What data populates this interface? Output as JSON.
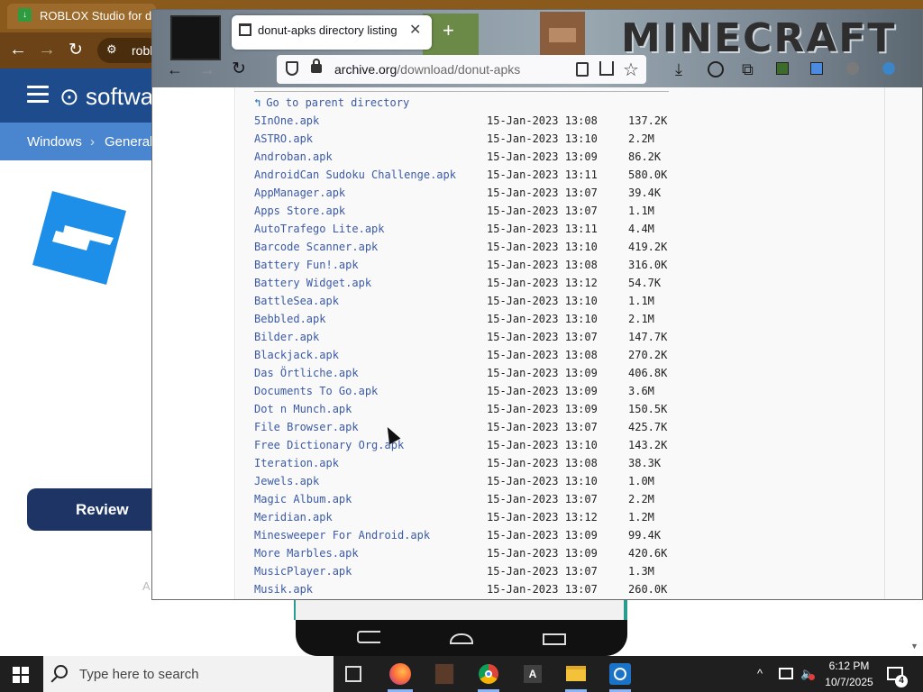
{
  "chrome": {
    "tab_title": "ROBLOX Studio for dell",
    "omnibox_text": "roblo",
    "site_logo": "softwa",
    "breadcrumb": [
      "Windows",
      "›",
      "General"
    ],
    "review_button": "Review",
    "ad_label": "A"
  },
  "firefox": {
    "tab_title": "donut-apks directory listing",
    "url_host": "archive.org",
    "url_path": "/download/donut-apks",
    "title_art": "MINECRAFT",
    "parent_link": "Go to parent directory",
    "parent_icon": "↰",
    "files": [
      {
        "name": "5InOne.apk",
        "date": "15-Jan-2023 13:08",
        "size": "137.2K"
      },
      {
        "name": "ASTRO.apk",
        "date": "15-Jan-2023 13:10",
        "size": "2.2M"
      },
      {
        "name": "Androban.apk",
        "date": "15-Jan-2023 13:09",
        "size": "86.2K"
      },
      {
        "name": "AndroidCan Sudoku Challenge.apk",
        "date": "15-Jan-2023 13:11",
        "size": "580.0K"
      },
      {
        "name": "AppManager.apk",
        "date": "15-Jan-2023 13:07",
        "size": "39.4K"
      },
      {
        "name": "Apps Store.apk",
        "date": "15-Jan-2023 13:07",
        "size": "1.1M"
      },
      {
        "name": "AutoTrafego Lite.apk",
        "date": "15-Jan-2023 13:11",
        "size": "4.4M"
      },
      {
        "name": "Barcode Scanner.apk",
        "date": "15-Jan-2023 13:10",
        "size": "419.2K"
      },
      {
        "name": "Battery Fun!.apk",
        "date": "15-Jan-2023 13:08",
        "size": "316.0K"
      },
      {
        "name": "Battery Widget.apk",
        "date": "15-Jan-2023 13:12",
        "size": "54.7K"
      },
      {
        "name": "BattleSea.apk",
        "date": "15-Jan-2023 13:10",
        "size": "1.1M"
      },
      {
        "name": "Bebbled.apk",
        "date": "15-Jan-2023 13:10",
        "size": "2.1M"
      },
      {
        "name": "Bilder.apk",
        "date": "15-Jan-2023 13:07",
        "size": "147.7K"
      },
      {
        "name": "Blackjack.apk",
        "date": "15-Jan-2023 13:08",
        "size": "270.2K"
      },
      {
        "name": "Das Örtliche.apk",
        "date": "15-Jan-2023 13:09",
        "size": "406.8K"
      },
      {
        "name": "Documents To Go.apk",
        "date": "15-Jan-2023 13:09",
        "size": "3.6M"
      },
      {
        "name": "Dot n Munch.apk",
        "date": "15-Jan-2023 13:09",
        "size": "150.5K"
      },
      {
        "name": "File Browser.apk",
        "date": "15-Jan-2023 13:07",
        "size": "425.7K"
      },
      {
        "name": "Free Dictionary Org.apk",
        "date": "15-Jan-2023 13:10",
        "size": "143.2K"
      },
      {
        "name": "Iteration.apk",
        "date": "15-Jan-2023 13:08",
        "size": "38.3K"
      },
      {
        "name": "Jewels.apk",
        "date": "15-Jan-2023 13:10",
        "size": "1.0M"
      },
      {
        "name": "Magic Album.apk",
        "date": "15-Jan-2023 13:07",
        "size": "2.2M"
      },
      {
        "name": "Meridian.apk",
        "date": "15-Jan-2023 13:12",
        "size": "1.2M"
      },
      {
        "name": "Minesweeper For Android.apk",
        "date": "15-Jan-2023 13:09",
        "size": "99.4K"
      },
      {
        "name": "More Marbles.apk",
        "date": "15-Jan-2023 13:09",
        "size": "420.6K"
      },
      {
        "name": "MusicPlayer.apk",
        "date": "15-Jan-2023 13:07",
        "size": "1.3M"
      },
      {
        "name": "Musik.apk",
        "date": "15-Jan-2023 13:07",
        "size": "260.0K"
      }
    ]
  },
  "taskbar": {
    "search_placeholder": "Type here to search",
    "time": "6:12 PM",
    "date": "10/7/2025",
    "notification_count": "4",
    "app_a_label": "A"
  },
  "icons": {
    "file_type": "document-icon",
    "parent": "folder-up-icon"
  }
}
